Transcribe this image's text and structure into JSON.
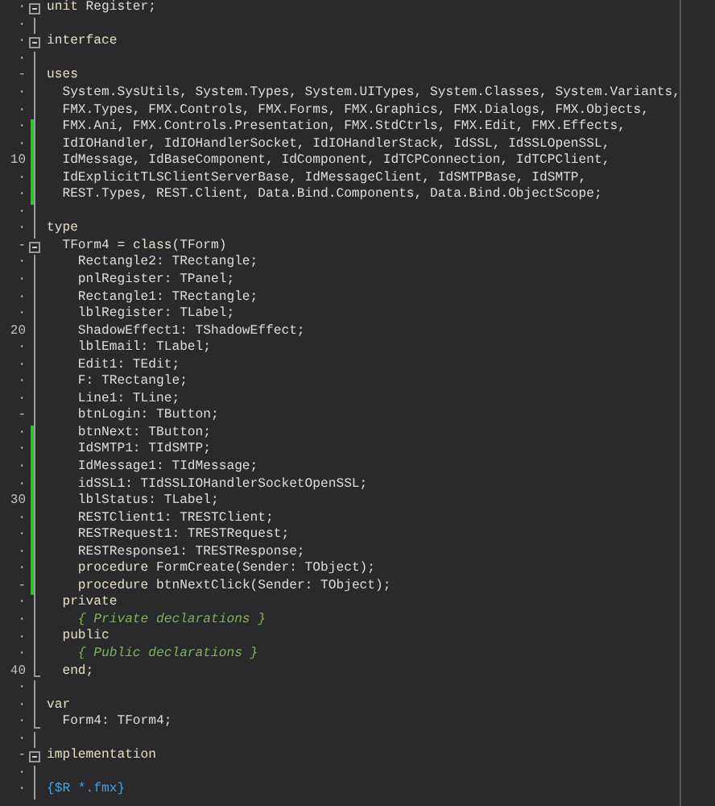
{
  "editor": {
    "lines": [
      {
        "gutter": "·",
        "modified": false,
        "foldable": true,
        "block_end": false,
        "segments": [
          {
            "kind": "keyword",
            "text": "unit"
          },
          {
            "kind": "code",
            "text": " Register;"
          }
        ]
      },
      {
        "gutter": "·",
        "modified": false,
        "foldable": false,
        "block_end": false
      },
      {
        "gutter": "·",
        "modified": false,
        "foldable": true,
        "block_end": false,
        "segments": [
          {
            "kind": "keyword",
            "text": "interface"
          }
        ]
      },
      {
        "gutter": "·",
        "modified": false,
        "foldable": false,
        "block_end": false
      },
      {
        "gutter": "-",
        "modified": false,
        "foldable": false,
        "block_end": false,
        "segments": [
          {
            "kind": "keyword",
            "text": "uses"
          }
        ]
      },
      {
        "gutter": "·",
        "modified": false,
        "foldable": false,
        "block_end": false,
        "segments": [
          {
            "kind": "code",
            "text": "  System.SysUtils, System.Types, System.UITypes, System.Classes, System.Variants,"
          }
        ]
      },
      {
        "gutter": "·",
        "modified": false,
        "foldable": false,
        "block_end": false,
        "segments": [
          {
            "kind": "code",
            "text": "  FMX.Types, FMX.Controls, FMX.Forms, FMX.Graphics, FMX.Dialogs, FMX.Objects,"
          }
        ]
      },
      {
        "gutter": "·",
        "modified": true,
        "foldable": false,
        "block_end": false,
        "segments": [
          {
            "kind": "code",
            "text": "  FMX.Ani, FMX.Controls.Presentation, FMX.StdCtrls, FMX.Edit, FMX.Effects,"
          }
        ]
      },
      {
        "gutter": "·",
        "modified": true,
        "foldable": false,
        "block_end": false,
        "segments": [
          {
            "kind": "code",
            "text": "  IdIOHandler, IdIOHandlerSocket, IdIOHandlerStack, IdSSL, IdSSLOpenSSL,"
          }
        ]
      },
      {
        "gutter": "10",
        "modified": true,
        "foldable": false,
        "block_end": false,
        "segments": [
          {
            "kind": "code",
            "text": "  IdMessage, IdBaseComponent, IdComponent, IdTCPConnection, IdTCPClient,"
          }
        ]
      },
      {
        "gutter": "·",
        "modified": true,
        "foldable": false,
        "block_end": false,
        "segments": [
          {
            "kind": "code",
            "text": "  IdExplicitTLSClientServerBase, IdMessageClient, IdSMTPBase, IdSMTP,"
          }
        ]
      },
      {
        "gutter": "·",
        "modified": true,
        "foldable": false,
        "block_end": false,
        "segments": [
          {
            "kind": "code",
            "text": "  REST.Types, REST.Client, Data.Bind.Components, Data.Bind.ObjectScope;"
          }
        ]
      },
      {
        "gutter": "·",
        "modified": false,
        "foldable": false,
        "block_end": false
      },
      {
        "gutter": "·",
        "modified": false,
        "foldable": false,
        "block_end": false,
        "segments": [
          {
            "kind": "keyword",
            "text": "type"
          }
        ]
      },
      {
        "gutter": "-",
        "modified": false,
        "foldable": true,
        "block_end": false,
        "segments": [
          {
            "kind": "code",
            "text": "  TForm4 = "
          },
          {
            "kind": "keyword",
            "text": "class"
          },
          {
            "kind": "code",
            "text": "(TForm)"
          }
        ]
      },
      {
        "gutter": "·",
        "modified": false,
        "foldable": false,
        "block_end": false,
        "segments": [
          {
            "kind": "code",
            "text": "    Rectangle2: TRectangle;"
          }
        ]
      },
      {
        "gutter": "·",
        "modified": false,
        "foldable": false,
        "block_end": false,
        "segments": [
          {
            "kind": "code",
            "text": "    pnlRegister: TPanel;"
          }
        ]
      },
      {
        "gutter": "·",
        "modified": false,
        "foldable": false,
        "block_end": false,
        "segments": [
          {
            "kind": "code",
            "text": "    Rectangle1: TRectangle;"
          }
        ]
      },
      {
        "gutter": "·",
        "modified": false,
        "foldable": false,
        "block_end": false,
        "segments": [
          {
            "kind": "code",
            "text": "    lblRegister: TLabel;"
          }
        ]
      },
      {
        "gutter": "20",
        "modified": false,
        "foldable": false,
        "block_end": false,
        "segments": [
          {
            "kind": "code",
            "text": "    ShadowEffect1: TShadowEffect;"
          }
        ]
      },
      {
        "gutter": "·",
        "modified": false,
        "foldable": false,
        "block_end": false,
        "segments": [
          {
            "kind": "code",
            "text": "    lblEmail: TLabel;"
          }
        ]
      },
      {
        "gutter": "·",
        "modified": false,
        "foldable": false,
        "block_end": false,
        "segments": [
          {
            "kind": "code",
            "text": "    Edit1: TEdit;"
          }
        ]
      },
      {
        "gutter": "·",
        "modified": false,
        "foldable": false,
        "block_end": false,
        "segments": [
          {
            "kind": "code",
            "text": "    F: TRectangle;"
          }
        ]
      },
      {
        "gutter": "·",
        "modified": false,
        "foldable": false,
        "block_end": false,
        "segments": [
          {
            "kind": "code",
            "text": "    Line1: TLine;"
          }
        ]
      },
      {
        "gutter": "-",
        "modified": false,
        "foldable": false,
        "block_end": false,
        "segments": [
          {
            "kind": "code",
            "text": "    btnLogin: TButton;"
          }
        ]
      },
      {
        "gutter": "·",
        "modified": true,
        "foldable": false,
        "block_end": false,
        "segments": [
          {
            "kind": "code",
            "text": "    btnNext: TButton;"
          }
        ]
      },
      {
        "gutter": "·",
        "modified": true,
        "foldable": false,
        "block_end": false,
        "segments": [
          {
            "kind": "code",
            "text": "    IdSMTP1: TIdSMTP;"
          }
        ]
      },
      {
        "gutter": "·",
        "modified": true,
        "foldable": false,
        "block_end": false,
        "segments": [
          {
            "kind": "code",
            "text": "    IdMessage1: TIdMessage;"
          }
        ]
      },
      {
        "gutter": "·",
        "modified": true,
        "foldable": false,
        "block_end": false,
        "segments": [
          {
            "kind": "code",
            "text": "    idSSL1: TIdSSLIOHandlerSocketOpenSSL;"
          }
        ]
      },
      {
        "gutter": "30",
        "modified": true,
        "foldable": false,
        "block_end": false,
        "segments": [
          {
            "kind": "code",
            "text": "    lblStatus: TLabel;"
          }
        ]
      },
      {
        "gutter": "·",
        "modified": true,
        "foldable": false,
        "block_end": false,
        "segments": [
          {
            "kind": "code",
            "text": "    RESTClient1: TRESTClient;"
          }
        ]
      },
      {
        "gutter": "·",
        "modified": true,
        "foldable": false,
        "block_end": false,
        "segments": [
          {
            "kind": "code",
            "text": "    RESTRequest1: TRESTRequest;"
          }
        ]
      },
      {
        "gutter": "·",
        "modified": true,
        "foldable": false,
        "block_end": false,
        "segments": [
          {
            "kind": "code",
            "text": "    RESTResponse1: TRESTResponse;"
          }
        ]
      },
      {
        "gutter": "·",
        "modified": true,
        "foldable": false,
        "block_end": false,
        "segments": [
          {
            "kind": "keyword",
            "text": "    procedure"
          },
          {
            "kind": "code",
            "text": " FormCreate(Sender: TObject);"
          }
        ]
      },
      {
        "gutter": "-",
        "modified": true,
        "foldable": false,
        "block_end": false,
        "segments": [
          {
            "kind": "keyword",
            "text": "    procedure"
          },
          {
            "kind": "code",
            "text": " btnNextClick(Sender: TObject);"
          }
        ]
      },
      {
        "gutter": "·",
        "modified": false,
        "foldable": false,
        "block_end": false,
        "segments": [
          {
            "kind": "keyword",
            "text": "  private"
          }
        ]
      },
      {
        "gutter": "·",
        "modified": false,
        "foldable": false,
        "block_end": false,
        "segments": [
          {
            "kind": "comment",
            "text": "    { Private declarations }"
          }
        ]
      },
      {
        "gutter": "·",
        "modified": false,
        "foldable": false,
        "block_end": false,
        "segments": [
          {
            "kind": "keyword",
            "text": "  public"
          }
        ]
      },
      {
        "gutter": "·",
        "modified": false,
        "foldable": false,
        "block_end": false,
        "segments": [
          {
            "kind": "comment",
            "text": "    { Public declarations }"
          }
        ]
      },
      {
        "gutter": "40",
        "modified": false,
        "foldable": false,
        "block_end": true,
        "segments": [
          {
            "kind": "keyword",
            "text": "  end"
          },
          {
            "kind": "code",
            "text": ";"
          }
        ]
      },
      {
        "gutter": "·",
        "modified": false,
        "foldable": false,
        "block_end": false
      },
      {
        "gutter": "·",
        "modified": false,
        "foldable": false,
        "block_end": false,
        "segments": [
          {
            "kind": "keyword",
            "text": "var"
          }
        ]
      },
      {
        "gutter": "·",
        "modified": false,
        "foldable": false,
        "block_end": true,
        "segments": [
          {
            "kind": "code",
            "text": "  Form4: TForm4;"
          }
        ]
      },
      {
        "gutter": "·",
        "modified": false,
        "foldable": false,
        "block_end": false
      },
      {
        "gutter": "-",
        "modified": false,
        "foldable": true,
        "block_end": false,
        "segments": [
          {
            "kind": "keyword",
            "text": "implementation"
          }
        ]
      },
      {
        "gutter": "·",
        "modified": false,
        "foldable": false,
        "block_end": false
      },
      {
        "gutter": "·",
        "modified": false,
        "foldable": false,
        "block_end": false,
        "segments": [
          {
            "kind": "directive",
            "text": "{$R *.fmx}"
          }
        ]
      }
    ]
  }
}
